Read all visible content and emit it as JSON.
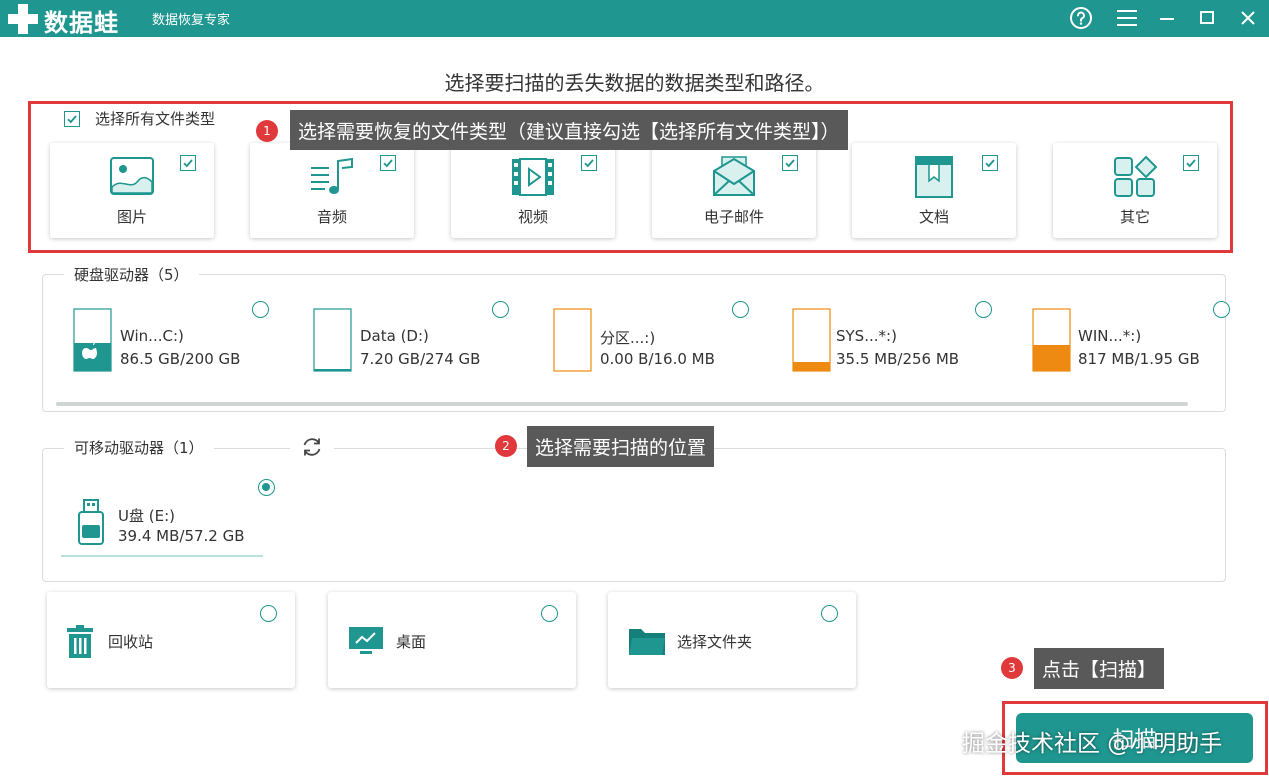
{
  "app": {
    "brand": "数据蛙",
    "subtitle": "数据恢复专家"
  },
  "colors": {
    "accent": "#1f9690",
    "highlight": "#e0393b",
    "tooltip": "#595959",
    "drive_orange": "#ee8a12"
  },
  "heading": "选择要扫描的丢失数据的数据类型和路径。",
  "filetypes": {
    "select_all_label": "选择所有文件类型",
    "items": [
      {
        "label": "图片",
        "icon": "image-icon",
        "checked": true
      },
      {
        "label": "音频",
        "icon": "music-icon",
        "checked": true
      },
      {
        "label": "视频",
        "icon": "video-icon",
        "checked": true
      },
      {
        "label": "电子邮件",
        "icon": "email-icon",
        "checked": true
      },
      {
        "label": "文档",
        "icon": "document-icon",
        "checked": true
      },
      {
        "label": "其它",
        "icon": "other-icon",
        "checked": true
      }
    ]
  },
  "tips": [
    {
      "num": "1",
      "text": "选择需要恢复的文件类型（建议直接勾选【选择所有文件类型】）"
    },
    {
      "num": "2",
      "text": "选择需要扫描的位置"
    },
    {
      "num": "3",
      "text": "点击【扫描】"
    }
  ],
  "hard_drives": {
    "title": "硬盘驱动器（5）",
    "items": [
      {
        "name": "Win...C:)",
        "size": "86.5 GB/200 GB",
        "fill": 0.43
      },
      {
        "name": "Data (D:)",
        "size": "7.20 GB/274 GB",
        "fill": 0.03
      },
      {
        "name": "分区...:)",
        "size": "0.00  B/16.0 MB",
        "fill": 0.0
      },
      {
        "name": "SYS...*:)",
        "size": "35.5 MB/256 MB",
        "fill": 0.14
      },
      {
        "name": "WIN...*:)",
        "size": "817 MB/1.95 GB",
        "fill": 0.41
      }
    ]
  },
  "removable": {
    "title": "可移动驱动器（1）",
    "items": [
      {
        "name": "U盘 (E:)",
        "size": "39.4 MB/57.2 GB",
        "selected": true
      }
    ]
  },
  "locations": [
    {
      "label": "回收站",
      "icon": "recycle-bin-icon"
    },
    {
      "label": "桌面",
      "icon": "desktop-icon"
    },
    {
      "label": "选择文件夹",
      "icon": "folder-icon"
    }
  ],
  "scan_button": "扫描",
  "watermark": "掘金技术社区 @小明助手"
}
